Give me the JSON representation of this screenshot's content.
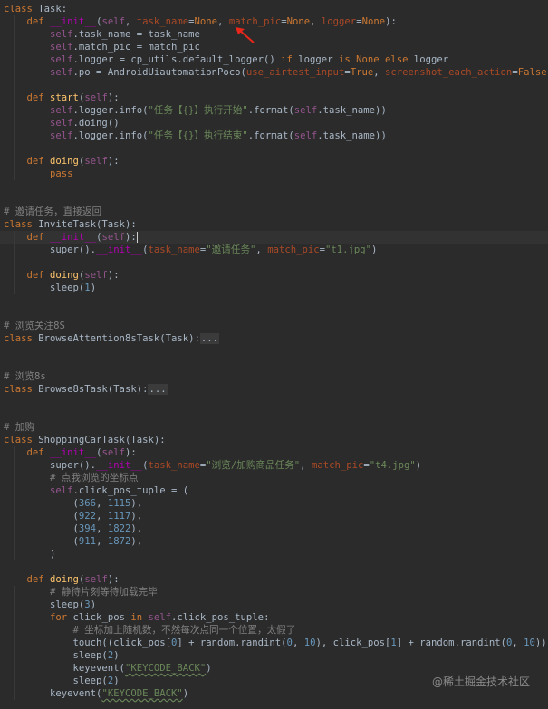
{
  "lines": [
    "class Task:",
    "    def __init__(self, task_name=None, match_pic=None, logger=None):",
    "        self.task_name = task_name",
    "        self.match_pic = match_pic",
    "        self.logger = cp_utils.default_logger() if logger is None else logger",
    "        self.po = AndroidUiautomationPoco(use_airtest_input=True, screenshot_each_action=False)",
    "",
    "    def start(self):",
    "        self.logger.info(\"任务【{}】执行开始\".format(self.task_name))",
    "        self.doing()",
    "        self.logger.info(\"任务【{}】执行结束\".format(self.task_name))",
    "",
    "    def doing(self):",
    "        pass",
    "",
    "",
    "# 邀请任务，直接返回",
    "class InviteTask(Task):",
    "    def __init__(self):",
    "        super().__init__(task_name=\"邀请任务\", match_pic=\"t1.jpg\")",
    "",
    "    def doing(self):",
    "        sleep(1)",
    "",
    "",
    "# 浏览关注8S",
    "class BrowseAttention8sTask(Task):...",
    "",
    "",
    "# 浏览8s",
    "class Browse8sTask(Task):...",
    "",
    "",
    "# 加购",
    "class ShoppingCarTask(Task):",
    "    def __init__(self):",
    "        super().__init__(task_name=\"浏览/加购商品任务\", match_pic=\"t4.jpg\")",
    "        # 点我浏览的坐标点",
    "        self.click_pos_tuple = (",
    "            (366, 1115),",
    "            (922, 1117),",
    "            (394, 1822),",
    "            (911, 1872),",
    "        )",
    "",
    "    def doing(self):",
    "        # 静待片刻等待加载完毕",
    "        sleep(3)",
    "        for click_pos in self.click_pos_tuple:",
    "            # 坐标加上随机数，不然每次点同一个位置，太假了",
    "            touch((click_pos[0] + random.randint(0, 10), click_pos[1] + random.randint(0, 10)))",
    "            sleep(2)",
    "            keyevent(\"KEYCODE_BACK\")",
    "            sleep(2)",
    "        keyevent(\"KEYCODE_BACK\")"
  ],
  "watermark": "@稀土掘金技术社区",
  "icons": {
    "annotation_arrow": "red-arrow-icon"
  },
  "colors": {
    "background": "#2b2b2b",
    "keyword": "#cc7832",
    "self": "#94558d",
    "function": "#ffc66d",
    "dunder": "#b200b2",
    "string": "#6a8759",
    "number": "#6897bb",
    "kwarg": "#aa4926",
    "comment": "#808080",
    "annotation_arrow": "#e8261a"
  }
}
